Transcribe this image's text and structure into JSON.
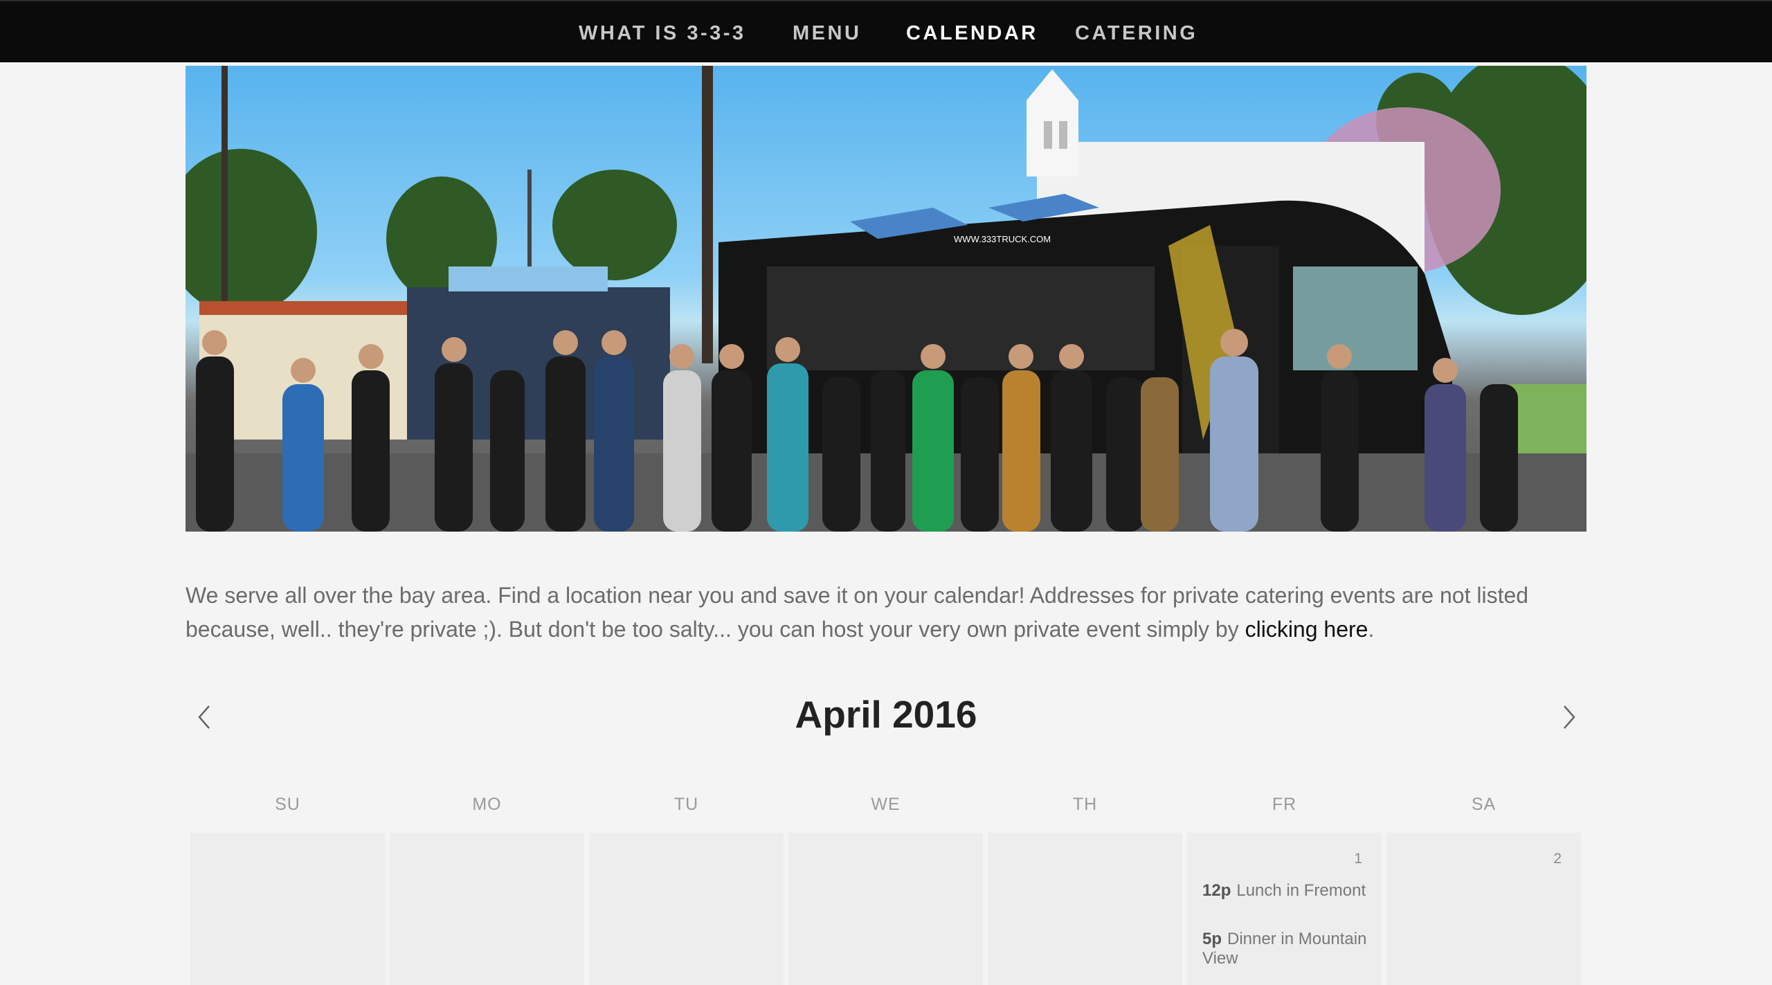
{
  "nav": {
    "items": [
      {
        "label": "WHAT IS 3-3-3"
      },
      {
        "label": "MENU"
      },
      {
        "label": "CALENDAR"
      },
      {
        "label": "CATERING"
      }
    ]
  },
  "intro": {
    "text": "We serve all over the bay area. Find a location near you and save it on your calendar! Addresses for private catering events are not listed because, well.. they're private ;). But don't be too salty... you can host your very own private event simply by ",
    "link_label": "clicking here",
    "end": "."
  },
  "calendar": {
    "month_title": "April 2016",
    "weekdays": [
      "SU",
      "MO",
      "TU",
      "WE",
      "TH",
      "FR",
      "SA"
    ],
    "first_week": [
      {
        "day": ""
      },
      {
        "day": ""
      },
      {
        "day": ""
      },
      {
        "day": ""
      },
      {
        "day": ""
      },
      {
        "day": "1",
        "events": [
          {
            "time": "12p",
            "title": "Lunch in Fremont"
          },
          {
            "time": "5p",
            "title": "Dinner in Mountain View"
          }
        ]
      },
      {
        "day": "2"
      }
    ]
  },
  "hero": {
    "truck_sign": "WWW.333TRUCK.COM"
  },
  "colors": {
    "nav_bg": "#0b0b0b",
    "page_bg": "#f4f4f4",
    "cell_bg": "#ededed"
  }
}
